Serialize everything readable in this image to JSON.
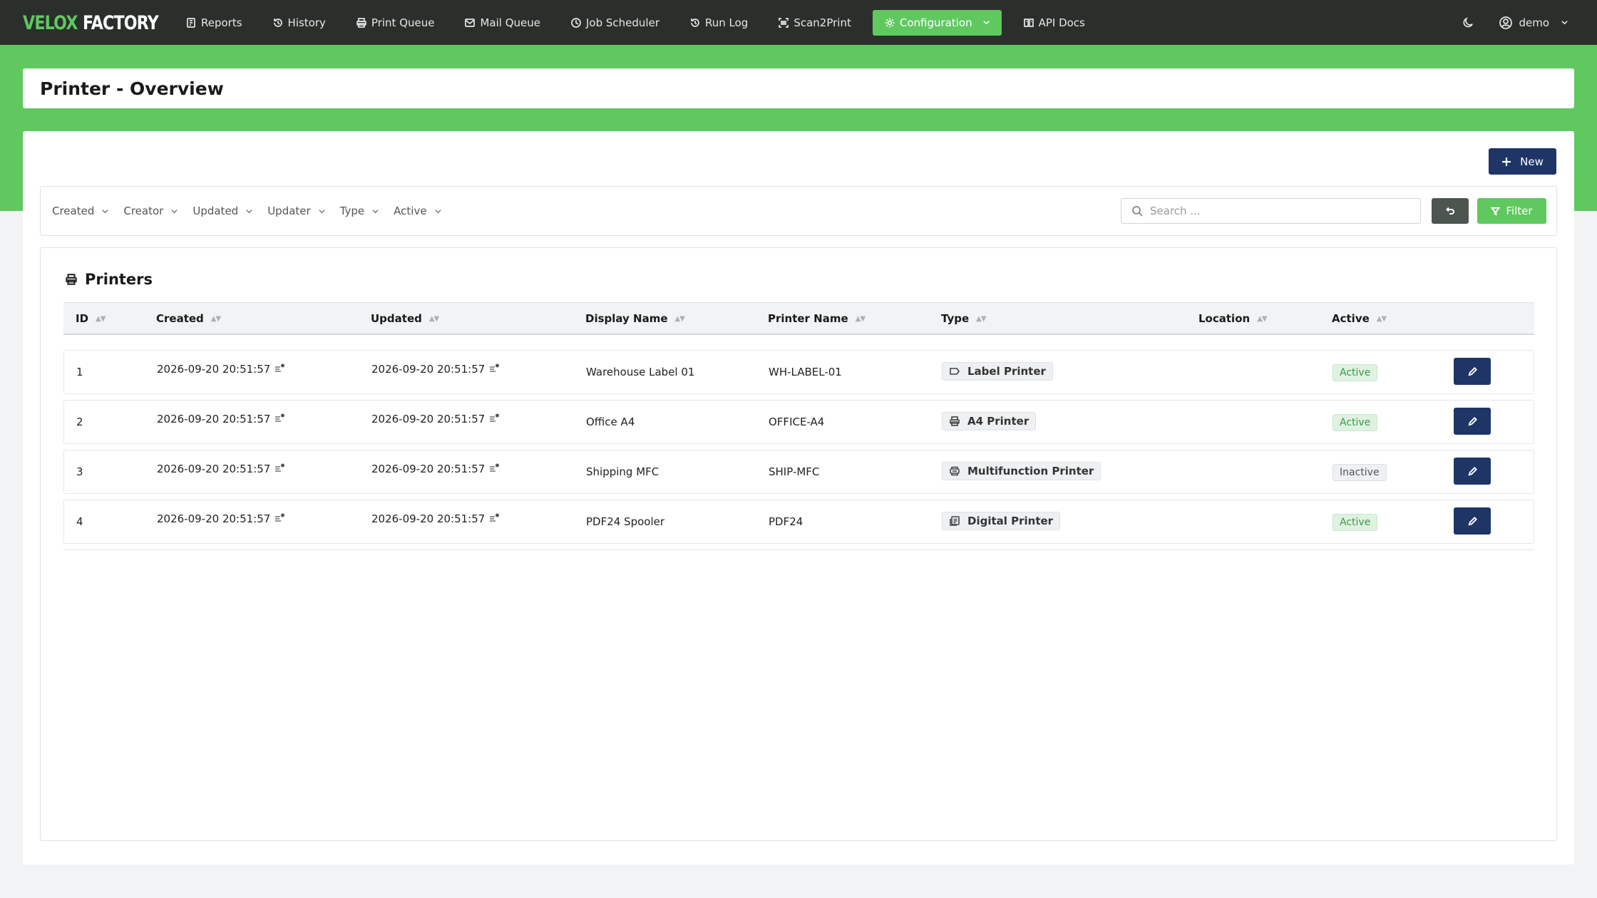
{
  "brand": {
    "part1": "VELOX",
    "part2": "FACTORY"
  },
  "nav": {
    "items": [
      {
        "label": "Reports",
        "icon": "reports-icon"
      },
      {
        "label": "History",
        "icon": "history-icon"
      },
      {
        "label": "Print Queue",
        "icon": "printer-icon"
      },
      {
        "label": "Mail Queue",
        "icon": "mail-icon"
      },
      {
        "label": "Job Scheduler",
        "icon": "clock-icon"
      },
      {
        "label": "Run Log",
        "icon": "history-icon"
      },
      {
        "label": "Scan2Print",
        "icon": "barcode-scan-icon"
      },
      {
        "label": "Configuration",
        "icon": "gear-icon"
      },
      {
        "label": "API Docs",
        "icon": "book-icon"
      }
    ],
    "active": "Configuration",
    "user": "demo"
  },
  "colors": {
    "brand_green": "#5fc85f",
    "navbar": "#2b2f2c",
    "primary_navy": "#1e3566"
  },
  "page": {
    "title": "Printer - Overview"
  },
  "toolbar": {
    "new_label": "New"
  },
  "filters": {
    "dropdowns": [
      "Created",
      "Creator",
      "Updated",
      "Updater",
      "Type",
      "Active"
    ],
    "search_placeholder": "Search ...",
    "search_value": "",
    "filter_label": "Filter"
  },
  "table": {
    "title": "Printers",
    "columns": [
      "ID",
      "Created",
      "Updated",
      "Display Name",
      "Printer Name",
      "Type",
      "Location",
      "Active"
    ],
    "rows": [
      {
        "id": "1",
        "created": "2026-09-20 20:51:57",
        "updated": "2026-09-20 20:51:57",
        "display_name": "Warehouse Label 01",
        "printer_name": "WH-LABEL-01",
        "type": "Label Printer",
        "type_icon": "label-tag-icon",
        "location": "",
        "active": "Active"
      },
      {
        "id": "2",
        "created": "2026-09-20 20:51:57",
        "updated": "2026-09-20 20:51:57",
        "display_name": "Office A4",
        "printer_name": "OFFICE-A4",
        "type": "A4 Printer",
        "type_icon": "printer-icon",
        "location": "",
        "active": "Active"
      },
      {
        "id": "3",
        "created": "2026-09-20 20:51:57",
        "updated": "2026-09-20 20:51:57",
        "display_name": "Shipping MFC",
        "printer_name": "SHIP-MFC",
        "type": "Multifunction Printer",
        "type_icon": "multifunction-printer-icon",
        "location": "",
        "active": "Inactive"
      },
      {
        "id": "4",
        "created": "2026-09-20 20:51:57",
        "updated": "2026-09-20 20:51:57",
        "display_name": "PDF24 Spooler",
        "printer_name": "PDF24",
        "type": "Digital Printer",
        "type_icon": "digital-document-icon",
        "location": "",
        "active": "Active"
      }
    ]
  }
}
